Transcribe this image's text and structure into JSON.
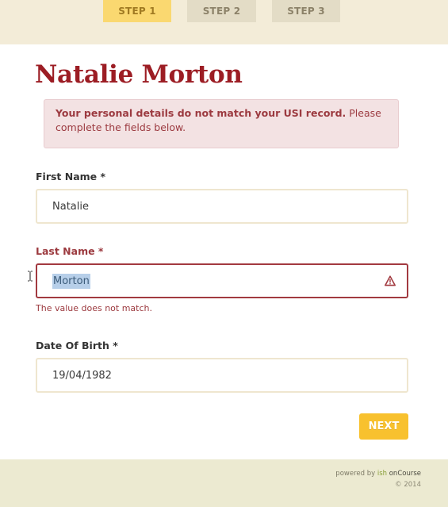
{
  "steps": [
    {
      "label": "STEP 1",
      "active": true
    },
    {
      "label": "STEP 2",
      "active": false
    },
    {
      "label": "STEP 3",
      "active": false
    }
  ],
  "page_title": "Natalie Morton",
  "alert": {
    "bold_text": "Your personal details do not match your USI record.",
    "text": " Please complete the fields below."
  },
  "form": {
    "first_name": {
      "label": "First Name *",
      "value": "Natalie"
    },
    "last_name": {
      "label": "Last Name *",
      "value": "Morton",
      "error": "The value does not match."
    },
    "dob": {
      "label": "Date Of Birth *",
      "value": "19/04/1982"
    }
  },
  "next_label": "NEXT",
  "footer": {
    "powered_prefix": "powered by ",
    "brand_ish": "ish",
    "brand_oncourse": " onCourse",
    "copyright": "© 2014"
  },
  "colors": {
    "accent_red": "#9c1d24",
    "step_active": "#fad870",
    "next_button": "#f8c12e",
    "error_border": "#a23a40"
  },
  "icons": {
    "field_warning": "warning-triangle-icon",
    "cursor": "text-cursor-icon"
  }
}
